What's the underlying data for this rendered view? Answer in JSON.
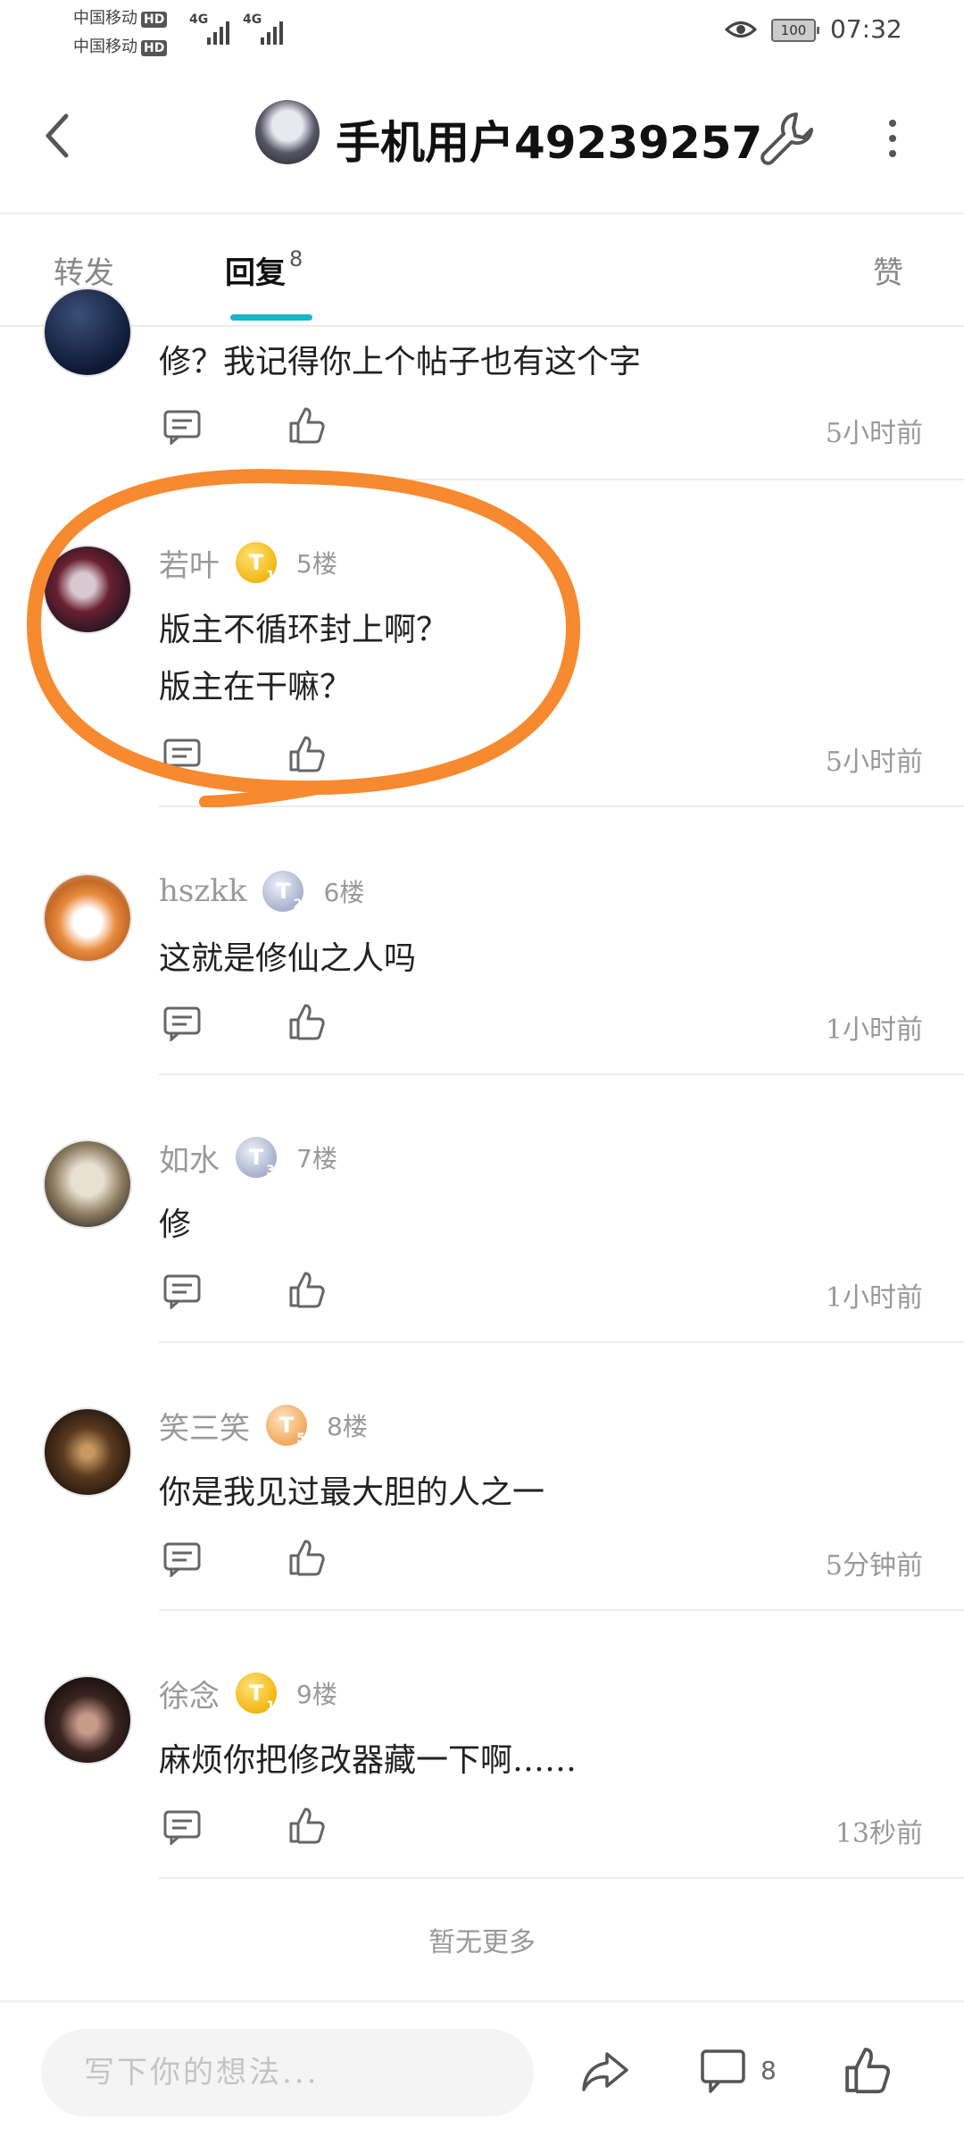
{
  "status_bar": {
    "carrier_1": "中国移动",
    "carrier_2": "中国移动",
    "hd": "HD",
    "network_1": "4G",
    "network_2": "4G",
    "battery": "100",
    "time": "07:32"
  },
  "header": {
    "title": "手机用户49239257",
    "back_icon": "chevron-left-icon",
    "tool_icon": "wrench-icon",
    "more_icon": "more-vertical-icon"
  },
  "tabs": {
    "forward": "转发",
    "reply": "回复",
    "reply_count": "8",
    "like": "赞"
  },
  "replies": [
    {
      "username": "",
      "floor": "",
      "lines": [
        "修？我记得你上个帖子也有这个字"
      ],
      "time": "5小时前"
    },
    {
      "username": "若叶",
      "badge": "T",
      "badge_level": "1",
      "floor": "5楼",
      "lines": [
        "版主不循环封上啊？",
        "版主在干嘛？"
      ],
      "time": "5小时前"
    },
    {
      "username": "hszkk",
      "badge": "T",
      "badge_level": "2",
      "floor": "6楼",
      "lines": [
        "这就是修仙之人吗"
      ],
      "time": "1小时前"
    },
    {
      "username": "如水",
      "badge": "T",
      "badge_level": "3",
      "floor": "7楼",
      "lines": [
        "修"
      ],
      "time": "1小时前"
    },
    {
      "username": "笑三笑",
      "badge": "T",
      "badge_level": "5",
      "floor": "8楼",
      "lines": [
        "你是我见过最大胆的人之一"
      ],
      "time": "5分钟前"
    },
    {
      "username": "徐念",
      "badge": "T",
      "badge_level": "1",
      "floor": "9楼",
      "lines": [
        "麻烦你把修改器藏一下啊……"
      ],
      "time": "13秒前"
    }
  ],
  "footer": {
    "no_more": "暂无更多",
    "input_placeholder": "写下你的想法...",
    "comment_count": "8"
  },
  "colors": {
    "accent": "#18b4c8",
    "highlight": "#f7892f"
  }
}
